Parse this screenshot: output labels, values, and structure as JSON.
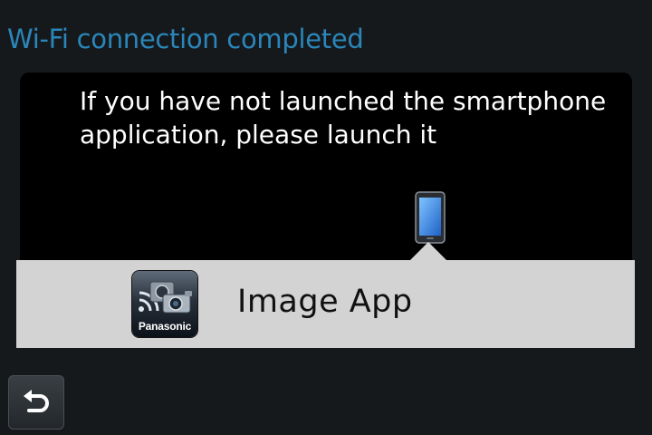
{
  "screen": {
    "title": "Wi-Fi connection completed",
    "message_lines": [
      "If you have not launched the smartphone",
      "application, please launch it"
    ]
  },
  "app": {
    "name": "Image App",
    "icon_brand": "Panasonic",
    "icon": "panasonic-image-app-icon"
  },
  "icons": {
    "smartphone": "smartphone-icon",
    "back": "return-arrow-icon"
  },
  "colors": {
    "title": "#2a86b9",
    "background": "#16191c",
    "panel": "#000000",
    "app_row": "#d3d3d3"
  }
}
